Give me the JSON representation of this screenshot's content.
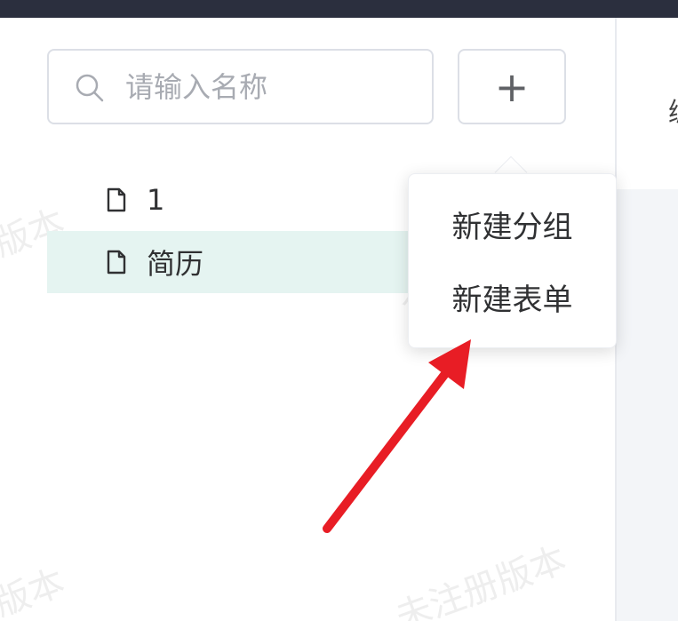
{
  "search": {
    "placeholder": "请输入名称",
    "icon": "search-icon"
  },
  "toolbar": {
    "add_label": "+",
    "add_icon": "plus-icon"
  },
  "tree": {
    "items": [
      {
        "label": "1",
        "icon": "file-icon",
        "selected": false
      },
      {
        "label": "简历",
        "icon": "file-icon",
        "selected": true
      }
    ]
  },
  "dropdown": {
    "items": [
      {
        "label": "新建分组"
      },
      {
        "label": "新建表单"
      }
    ]
  },
  "watermark": {
    "text": "未注册版本",
    "short_text": "版本"
  },
  "main": {
    "cut_text": "编"
  },
  "colors": {
    "topbar": "#2b2f3e",
    "selected_row": "#e5f4f1",
    "annotation_arrow": "#e81d25",
    "main_background": "#f3f5f8"
  }
}
